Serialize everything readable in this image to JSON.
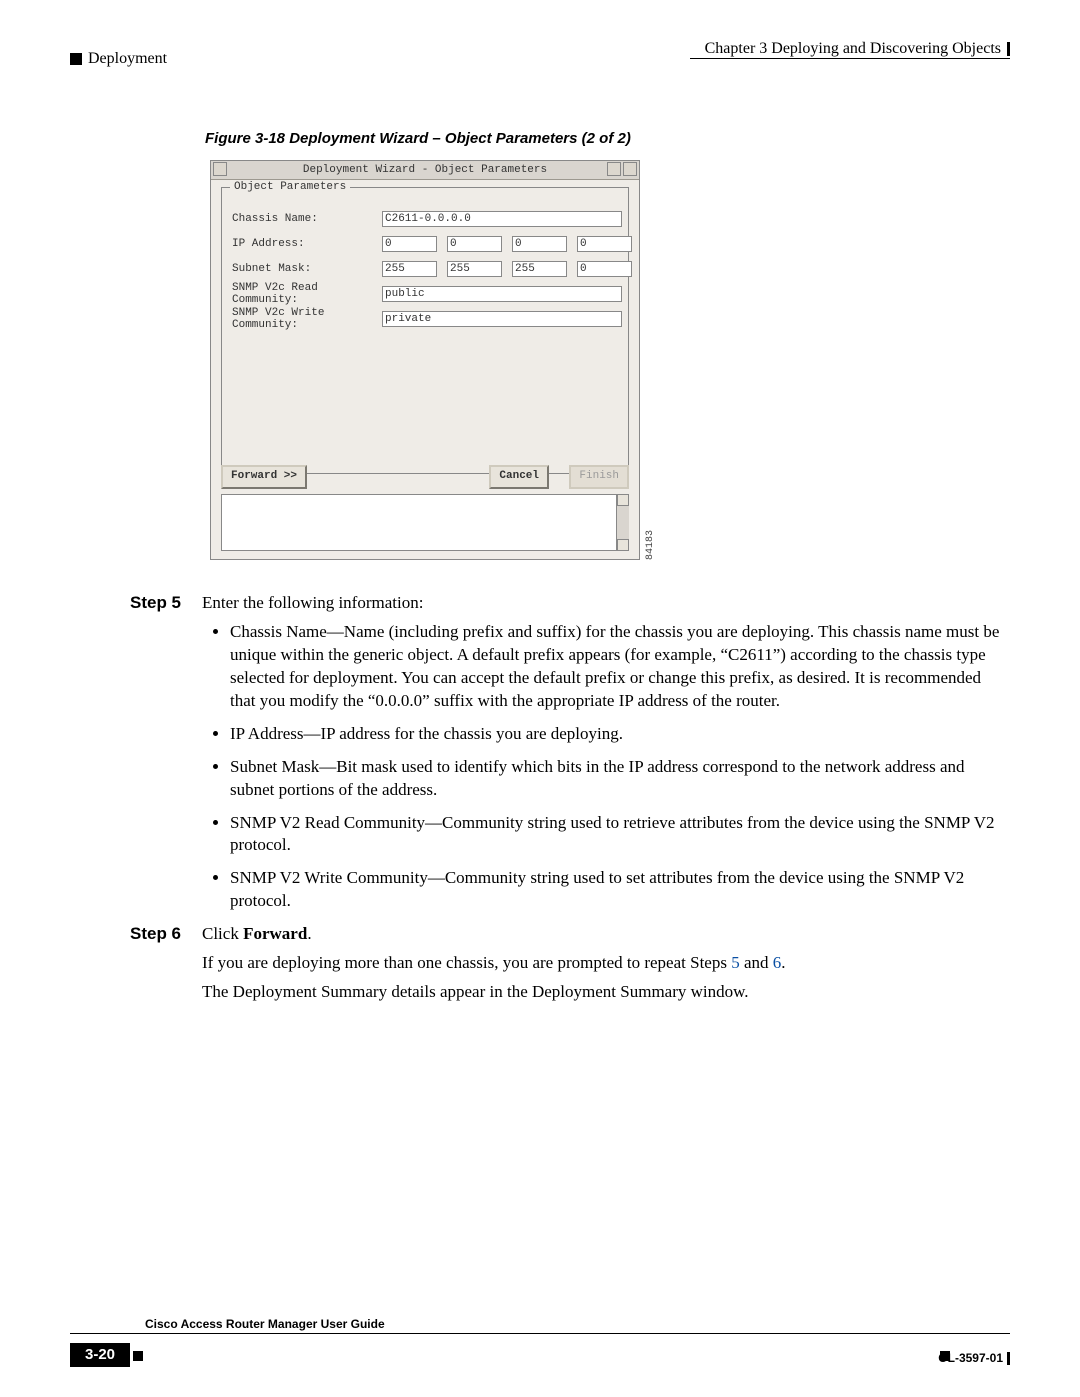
{
  "header": {
    "section": "Deployment",
    "chapter": "Chapter 3      Deploying and Discovering Objects"
  },
  "figure": {
    "caption": "Figure 3-18   Deployment Wizard – Object Parameters (2 of 2)",
    "id": "84183"
  },
  "wizard": {
    "title": "Deployment Wizard - Object Parameters",
    "group": "Object Parameters",
    "labels": {
      "chassis": "Chassis Name:",
      "ip": "IP Address:",
      "mask": "Subnet Mask:",
      "read": "SNMP V2c Read Community:",
      "write": "SNMP V2c Write Community:"
    },
    "values": {
      "chassis": "C2611-0.0.0.0",
      "ip": [
        "0",
        "0",
        "0",
        "0"
      ],
      "mask": [
        "255",
        "255",
        "255",
        "0"
      ],
      "read": "public",
      "write": "private"
    },
    "buttons": {
      "forward": "Forward >>",
      "cancel": "Cancel",
      "finish": "Finish"
    }
  },
  "steps": {
    "s5": {
      "label": "Step 5",
      "text": "Enter the following information:"
    },
    "bullets": {
      "b1": "Chassis Name—Name (including prefix and suffix) for the chassis you are deploying. This chassis name must be unique within the generic object. A default prefix appears (for example, “C2611”) according to the chassis type selected for deployment. You can accept the default prefix or change this prefix, as desired. It is recommended that you modify the “0.0.0.0” suffix with the appropriate IP address of the router.",
      "b2": "IP Address—IP address for the chassis you are deploying.",
      "b3": "Subnet Mask—Bit mask used to identify which bits in the IP address correspond to the network address and subnet portions of the address.",
      "b4": "SNMP V2 Read Community—Community string used to retrieve attributes from the device using the SNMP V2 protocol.",
      "b5": "SNMP V2 Write Community—Community string used to set attributes from the device using the SNMP V2 protocol."
    },
    "s6": {
      "label": "Step 6",
      "pre": "Click ",
      "bold": "Forward",
      "post": "."
    },
    "p1": {
      "pre": "If you are deploying more than one chassis, you are prompted to repeat Steps ",
      "l1": "5",
      "mid": " and ",
      "l2": "6",
      "post": "."
    },
    "p2": "The Deployment Summary details appear in the Deployment Summary window."
  },
  "footer": {
    "guide": "Cisco Access Router Manager User Guide",
    "page": "3-20",
    "docid": "OL-3597-01"
  }
}
